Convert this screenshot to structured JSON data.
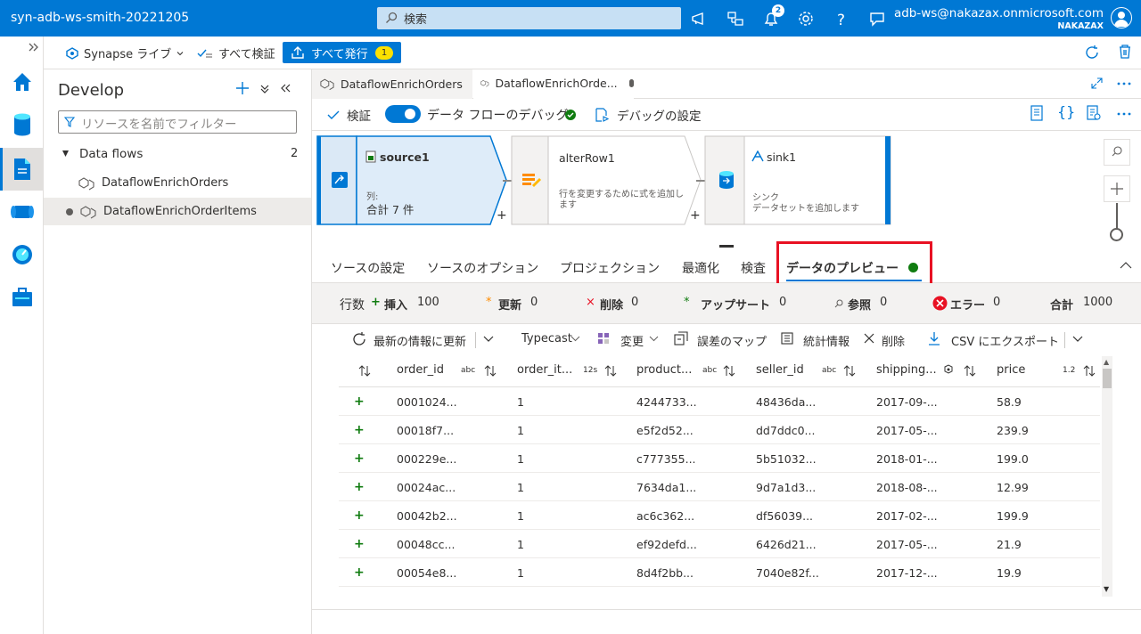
{
  "top_bar": {
    "workspace_name": "syn-adb-ws-smith-20221205",
    "search_placeholder": "検索",
    "notification_count": "2",
    "user_email": "adb-ws@nakazax.onmicrosoft.com",
    "user_tenant": "NAKAZAX"
  },
  "toolbar": {
    "synapse_live": "Synapse ライブ",
    "validate_all": "すべて検証",
    "publish_all": "すべて発行",
    "publish_count": "1"
  },
  "develop": {
    "title": "Develop",
    "filter_placeholder": "リソースを名前でフィルター",
    "section": "Data flows",
    "section_count": "2",
    "items": [
      "DataflowEnrichOrders",
      "DataflowEnrichOrderItems"
    ]
  },
  "editor": {
    "tabs": [
      "DataflowEnrichOrders",
      "DataflowEnrichOrde..."
    ],
    "validate": "検証",
    "debug_label": "データ フローのデバッグ",
    "debug_settings": "デバッグの設定"
  },
  "canvas": {
    "source": {
      "name": "source1",
      "label": "列:",
      "value": "合計 7 件"
    },
    "alter": {
      "name": "alterRow1",
      "desc": "行を変更するために式を追加します"
    },
    "sink": {
      "name": "sink1",
      "label": "シンク",
      "desc": "データセットを追加します"
    }
  },
  "lower_tabs": [
    "ソースの設定",
    "ソースのオプション",
    "プロジェクション",
    "最適化",
    "検査",
    "データのプレビュー"
  ],
  "stats": {
    "rows_label": "行数",
    "insert_label": "挿入",
    "insert": "100",
    "update_label": "更新",
    "update": "0",
    "delete_label": "削除",
    "delete": "0",
    "upsert_label": "アップサート",
    "upsert": "0",
    "lookup_label": "参照",
    "lookup": "0",
    "error_label": "エラー",
    "error": "0",
    "total_label": "合計",
    "total": "1000"
  },
  "grid_toolbar": {
    "refresh": "最新の情報に更新",
    "typecast": "Typecast",
    "modify": "変更",
    "map_drifted": "誤差のマップ",
    "statistics": "統計情報",
    "remove": "削除",
    "export": "CSV にエクスポート"
  },
  "grid": {
    "columns": [
      {
        "name": "order_id",
        "type": "abc"
      },
      {
        "name": "order_it...",
        "type": "12s"
      },
      {
        "name": "product...",
        "type": "abc"
      },
      {
        "name": "seller_id",
        "type": "abc"
      },
      {
        "name": "shipping...",
        "type": ""
      },
      {
        "name": "price",
        "type": "1.2"
      }
    ],
    "rows": [
      [
        "0001024...",
        "1",
        "4244733...",
        "48436da...",
        "2017-09-...",
        "58.9"
      ],
      [
        "00018f7...",
        "1",
        "e5f2d52...",
        "dd7ddc0...",
        "2017-05-...",
        "239.9"
      ],
      [
        "000229e...",
        "1",
        "c777355...",
        "5b51032...",
        "2018-01-...",
        "199.0"
      ],
      [
        "00024ac...",
        "1",
        "7634da1...",
        "9d7a1d3...",
        "2018-08-...",
        "12.99"
      ],
      [
        "00042b2...",
        "1",
        "ac6c362...",
        "df56039...",
        "2017-02-...",
        "199.9"
      ],
      [
        "00048cc...",
        "1",
        "ef92defd...",
        "6426d21...",
        "2017-05-...",
        "21.9"
      ],
      [
        "00054e8...",
        "1",
        "8d4f2bb...",
        "7040e82f...",
        "2017-12-...",
        "19.9"
      ]
    ]
  },
  "colors": {
    "accent": "#0078d4",
    "highlight": "#e81123",
    "insert": "#107c10"
  }
}
